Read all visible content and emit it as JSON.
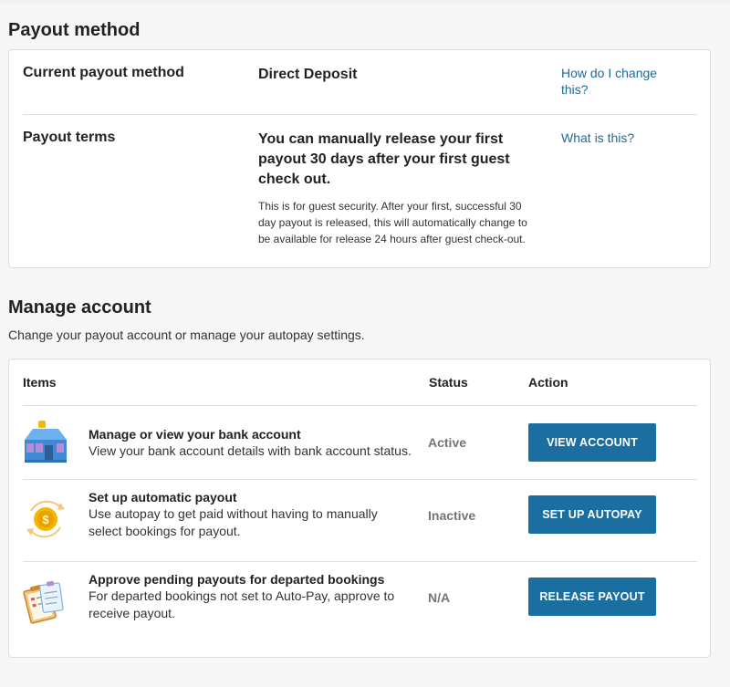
{
  "payout_method": {
    "heading": "Payout method",
    "current_label": "Current payout method",
    "current_value": "Direct Deposit",
    "current_help": "How do I change this?",
    "terms_label": "Payout terms",
    "terms_value": "You can manually release your first payout 30 days after your first guest check out.",
    "terms_note": "This is for guest security. After your first, successful 30 day payout is released, this will automatically change to be available for release 24 hours after guest check-out.",
    "terms_help": "What is this?"
  },
  "manage_account": {
    "heading": "Manage account",
    "subtitle": "Change your payout account or manage your autopay settings.",
    "columns": {
      "items": "Items",
      "status": "Status",
      "action": "Action"
    },
    "rows": [
      {
        "icon": "bank-building-icon",
        "title": "Manage or view your bank account",
        "description": "View your bank account details with bank account status.",
        "status": "Active",
        "action": "VIEW ACCOUNT"
      },
      {
        "icon": "autopay-coin-icon",
        "title": "Set up automatic payout",
        "description": "Use autopay to get paid without having to manually select bookings for payout.",
        "status": "Inactive",
        "action": "SET UP AUTOPAY"
      },
      {
        "icon": "clipboard-checklist-icon",
        "title": "Approve pending payouts for departed bookings",
        "description": "For departed bookings not set to Auto-Pay, approve to receive payout.",
        "status": "N/A",
        "action": "RELEASE PAYOUT"
      }
    ]
  },
  "colors": {
    "button": "#1a6fa0",
    "link": "#1e6b96",
    "status": "#757575"
  }
}
